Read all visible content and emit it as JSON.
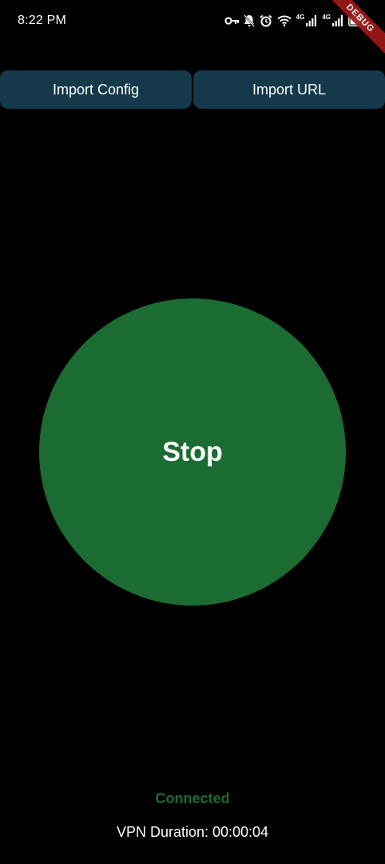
{
  "status_bar": {
    "time": "8:22 PM",
    "network_label_1": "4G",
    "network_label_2": "4G",
    "icons": [
      "key-icon",
      "bell-muted-icon",
      "alarm-icon",
      "wifi-icon",
      "signal-icon",
      "signal-icon",
      "battery-icon"
    ]
  },
  "debug_banner": "DEBUG",
  "toolbar": {
    "import_config_label": "Import Config",
    "import_url_label": "Import URL"
  },
  "main_button": {
    "label": "Stop"
  },
  "connection": {
    "status": "Connected",
    "duration": "VPN Duration: 00:00:04"
  },
  "colors": {
    "background": "#000000",
    "button_bg": "#13394a",
    "accent_green": "#1b6b32",
    "text": "#ffffff"
  }
}
